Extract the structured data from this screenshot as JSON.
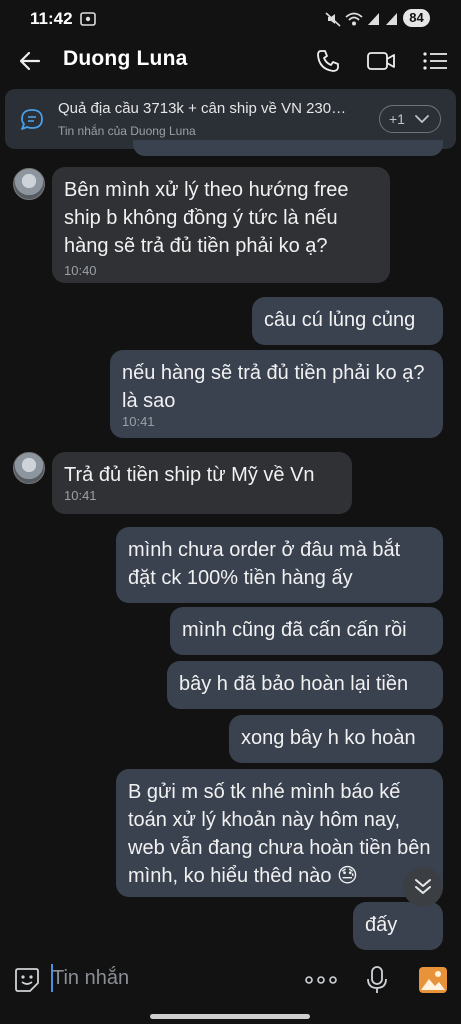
{
  "status_bar": {
    "time": "11:42",
    "battery": "84"
  },
  "header": {
    "contact_name": "Duong Luna"
  },
  "pinned": {
    "title": "Quả địa cầu 3713k + cân ship về VN 230…",
    "subtitle": "Tin nhắn của Duong Luna",
    "more_label": "+1"
  },
  "messages": [
    {
      "dir": "in",
      "text": "Bên mình xử lý theo hướng free ship b không đồng ý tức là nếu hàng sẽ trả đủ tiền phải ko ạ?",
      "time": "10:40"
    },
    {
      "dir": "out",
      "text": "câu cú lủng củng"
    },
    {
      "dir": "out",
      "text": "nếu hàng sẽ trả đủ tiền phải ko ạ? là sao",
      "time": "10:41"
    },
    {
      "dir": "in",
      "text": "Trả đủ tiền ship từ Mỹ về Vn",
      "time": "10:41"
    },
    {
      "dir": "out",
      "text": "mình chưa order ở đâu mà bắt đặt ck 100% tiền hàng ấy"
    },
    {
      "dir": "out",
      "text": "mình cũng đã cấn cấn rồi"
    },
    {
      "dir": "out",
      "text": "bây h đã bảo hoàn lại tiền"
    },
    {
      "dir": "out",
      "text": "xong bây h ko hoàn"
    },
    {
      "dir": "out",
      "text": "B gửi m số tk nhé mình báo kế toán xử lý khoản này hôm nay, web vẫn đang chưa hoàn tiền bên mình, ko hiểu thêd nào 😓"
    },
    {
      "dir": "out",
      "text": "đấy"
    }
  ],
  "composer": {
    "placeholder": "Tin nhắn"
  }
}
